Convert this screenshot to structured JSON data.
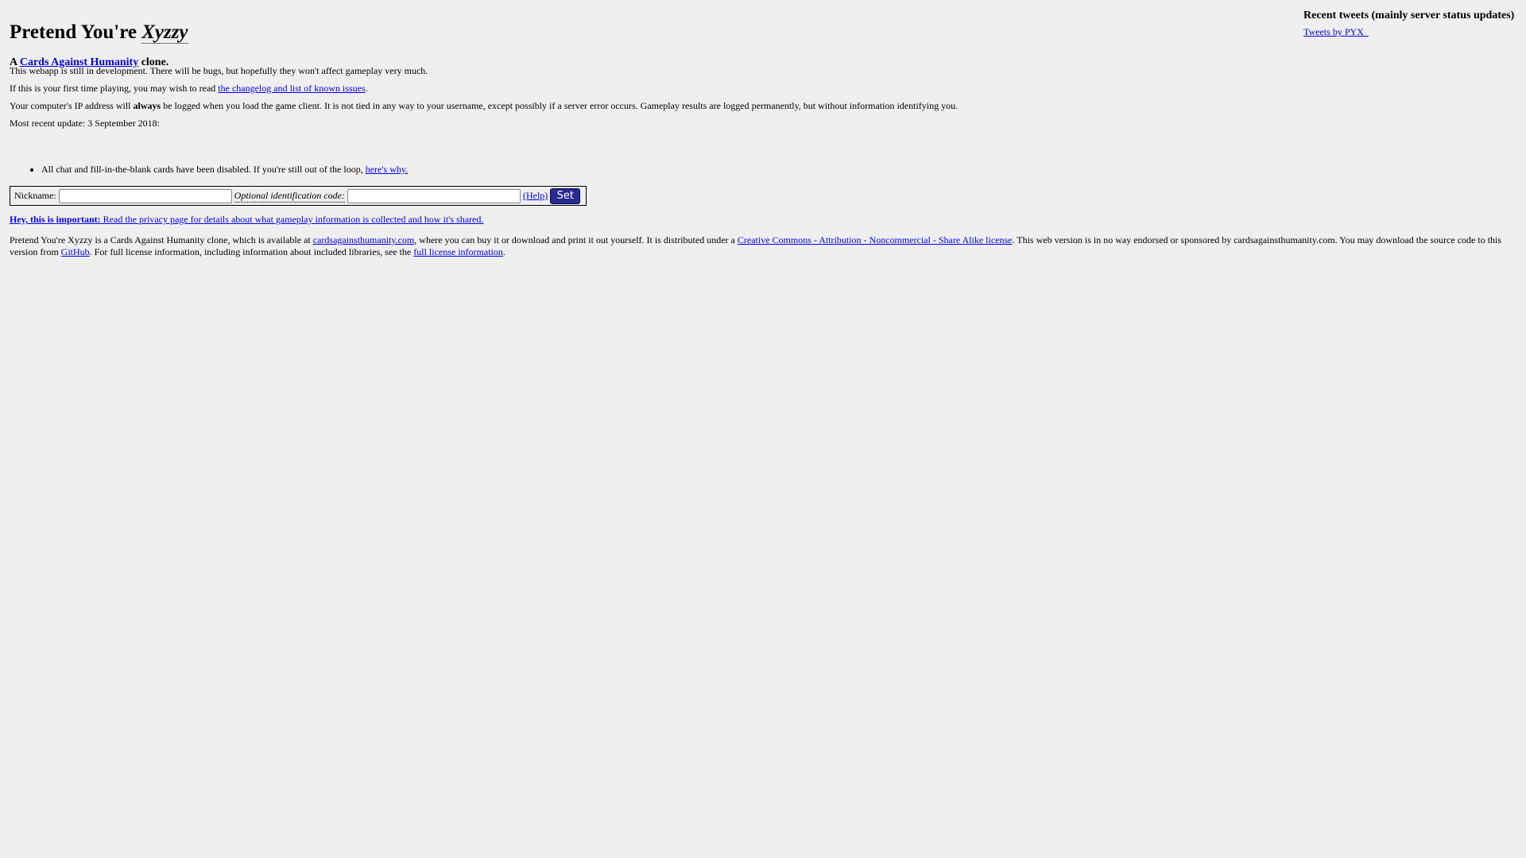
{
  "header": {
    "title_prefix": "Pretend You're ",
    "title_em": "Xyzzy",
    "subtitle_prefix": "A ",
    "subtitle_link": "Cards Against Humanity",
    "subtitle_suffix": " clone."
  },
  "intro": {
    "dev_notice": "This webapp is still in development. There will be bugs, but hopefully they won't affect gameplay very much.",
    "first_time_prefix": "If this is your first time playing, you may wish to read ",
    "changelog_link": "the changelog and list of known issues",
    "first_time_suffix": ".",
    "ip_prefix": "Your computer's IP address will ",
    "ip_bold": "always",
    "ip_suffix": " be logged when you load the game client. It is not tied in any way to your username, except possibly if a server error occurs. Gameplay results are logged permanently, but without information identifying you.",
    "update_label": "Most recent update: 3 September 2018:"
  },
  "updates": [
    {
      "text": "All chat and fill-in-the-blank cards have been disabled. If you're still out of the loop, ",
      "link": "here's why."
    }
  ],
  "nickname_form": {
    "nickname_label": "Nickname:",
    "nickname_value": "",
    "id_code_label": "Optional identification code:",
    "id_code_value": "",
    "help_link": "(Help)",
    "set_button": "Set"
  },
  "privacy": {
    "bold": "Hey, this is important:",
    "text": " Read the privacy page for details about what gameplay information is collected and how it's shared."
  },
  "license": {
    "t1": "Pretend You're Xyzzy is a Cards Against Humanity clone, which is available at ",
    "link_cah": "cardsagainsthumanity.com",
    "t2": ", where you can buy it or download and print it out yourself. It is distributed under a ",
    "link_cc": "Creative Commons - Attribution - Noncommercial - Share Alike license",
    "t3": ". This web version is in no way endorsed or sponsored by cardsagainsthumanity.com. You may download the source code to this version from ",
    "link_github": "GitHub",
    "t4": ". For full license information, including information about included libraries, see the ",
    "link_full": "full license information",
    "t5": "."
  },
  "tweets": {
    "heading": "Recent tweets (mainly server status updates)",
    "link": "Tweets by  PYX_"
  },
  "colors": {
    "background": "#efefef",
    "link": "#0000ee",
    "set_button": "#2a2a90"
  }
}
